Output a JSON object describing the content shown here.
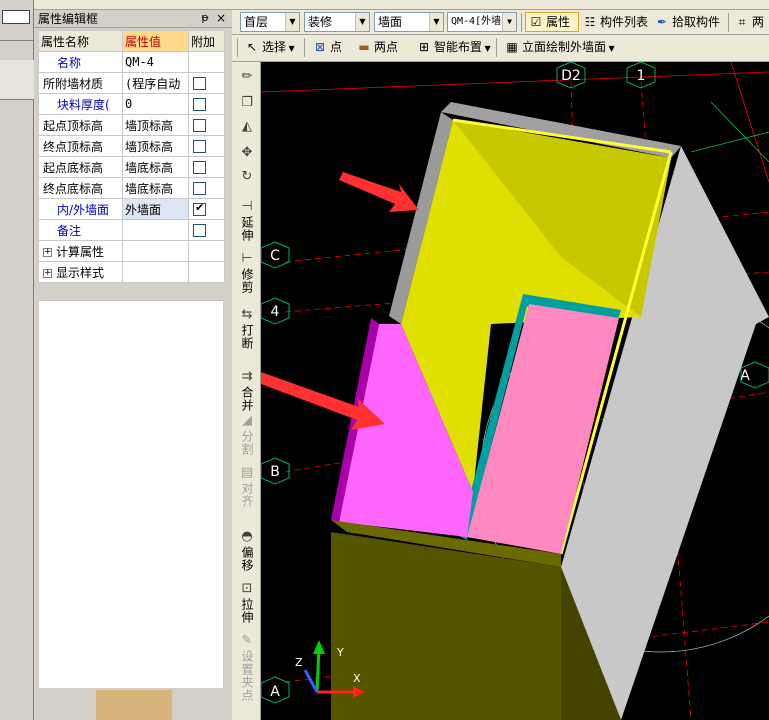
{
  "panel": {
    "title": "属性编辑框",
    "pin_glyph": "ᵽ",
    "close_glyph": "×",
    "headers": {
      "name": "属性名称",
      "value": "属性值",
      "extra": "附加"
    },
    "rows": [
      {
        "name": "名称",
        "value": "QM-4",
        "checkbox": false,
        "has_checkbox": false
      },
      {
        "name": "所附墙材质",
        "value": "(程序自动",
        "checkbox": false,
        "has_checkbox": true
      },
      {
        "name": "块料厚度(",
        "value": "0",
        "checkbox": false,
        "has_checkbox": true
      },
      {
        "name": "起点顶标高",
        "value": "墙顶标高",
        "checkbox": false,
        "has_checkbox": true
      },
      {
        "name": "终点顶标高",
        "value": "墙顶标高",
        "checkbox": false,
        "has_checkbox": true
      },
      {
        "name": "起点底标高",
        "value": "墙底标高",
        "checkbox": false,
        "has_checkbox": true
      },
      {
        "name": "终点底标高",
        "value": "墙底标高",
        "checkbox": false,
        "has_checkbox": true
      },
      {
        "name": "内/外墙面",
        "value": "外墙面",
        "checkbox": true,
        "has_checkbox": true
      },
      {
        "name": "备注",
        "value": "",
        "checkbox": false,
        "has_checkbox": true
      }
    ],
    "groups": [
      {
        "expander": "+",
        "label": "计算属性"
      },
      {
        "expander": "+",
        "label": "显示样式"
      }
    ]
  },
  "toolbar1": {
    "floor": "首层",
    "category": "装修",
    "type": "墙面",
    "component": "QM-4[外墙",
    "properties_label": "属性",
    "component_list_label": "构件列表",
    "pick_component_label": "拾取构件",
    "two_label": "两"
  },
  "toolbar2": {
    "select_label": "选择",
    "point_label": "点",
    "two_points_label": "两点",
    "smart_layout_label": "智能布置",
    "elevation_draw_label": "立面绘制外墙面"
  },
  "vtools": [
    {
      "icon": "extend-icon",
      "glyph": "⊣",
      "label": "延伸",
      "disabled": false
    },
    {
      "icon": "trim-icon",
      "glyph": "⊢",
      "label": "修剪",
      "disabled": false
    },
    {
      "icon": "break-icon",
      "glyph": "⇆",
      "label": "打断",
      "disabled": false
    },
    {
      "icon": "merge-icon",
      "glyph": "⇉",
      "label": "合并",
      "disabled": false
    },
    {
      "icon": "split-icon",
      "glyph": "◢",
      "label": "分割",
      "disabled": true
    },
    {
      "icon": "align-icon",
      "glyph": "▤",
      "label": "对齐",
      "disabled": true
    },
    {
      "icon": "offset-icon",
      "glyph": "◓",
      "label": "偏移",
      "disabled": false
    },
    {
      "icon": "stretch-icon",
      "glyph": "⊡",
      "label": "拉伸",
      "disabled": false
    },
    {
      "icon": "set-insert-point-icon",
      "glyph": "✎",
      "label": "设置夹点",
      "disabled": true
    }
  ],
  "axis_labels": {
    "d2": "D2",
    "one": "1",
    "c": "C",
    "four": "4",
    "a_right": "A",
    "b": "B",
    "a": "A"
  },
  "axes_gizmo": {
    "x": "X",
    "y": "Y",
    "z": "Z"
  },
  "colors": {
    "viewport_bg": "#000000",
    "wall_yellow": "#ffff33",
    "wall_magenta": "#ff66ff",
    "wall_grey": "#c8c8c8",
    "arrow_red": "#ff3030",
    "grid_red": "#ff0000",
    "teal": "#00a0a0"
  }
}
